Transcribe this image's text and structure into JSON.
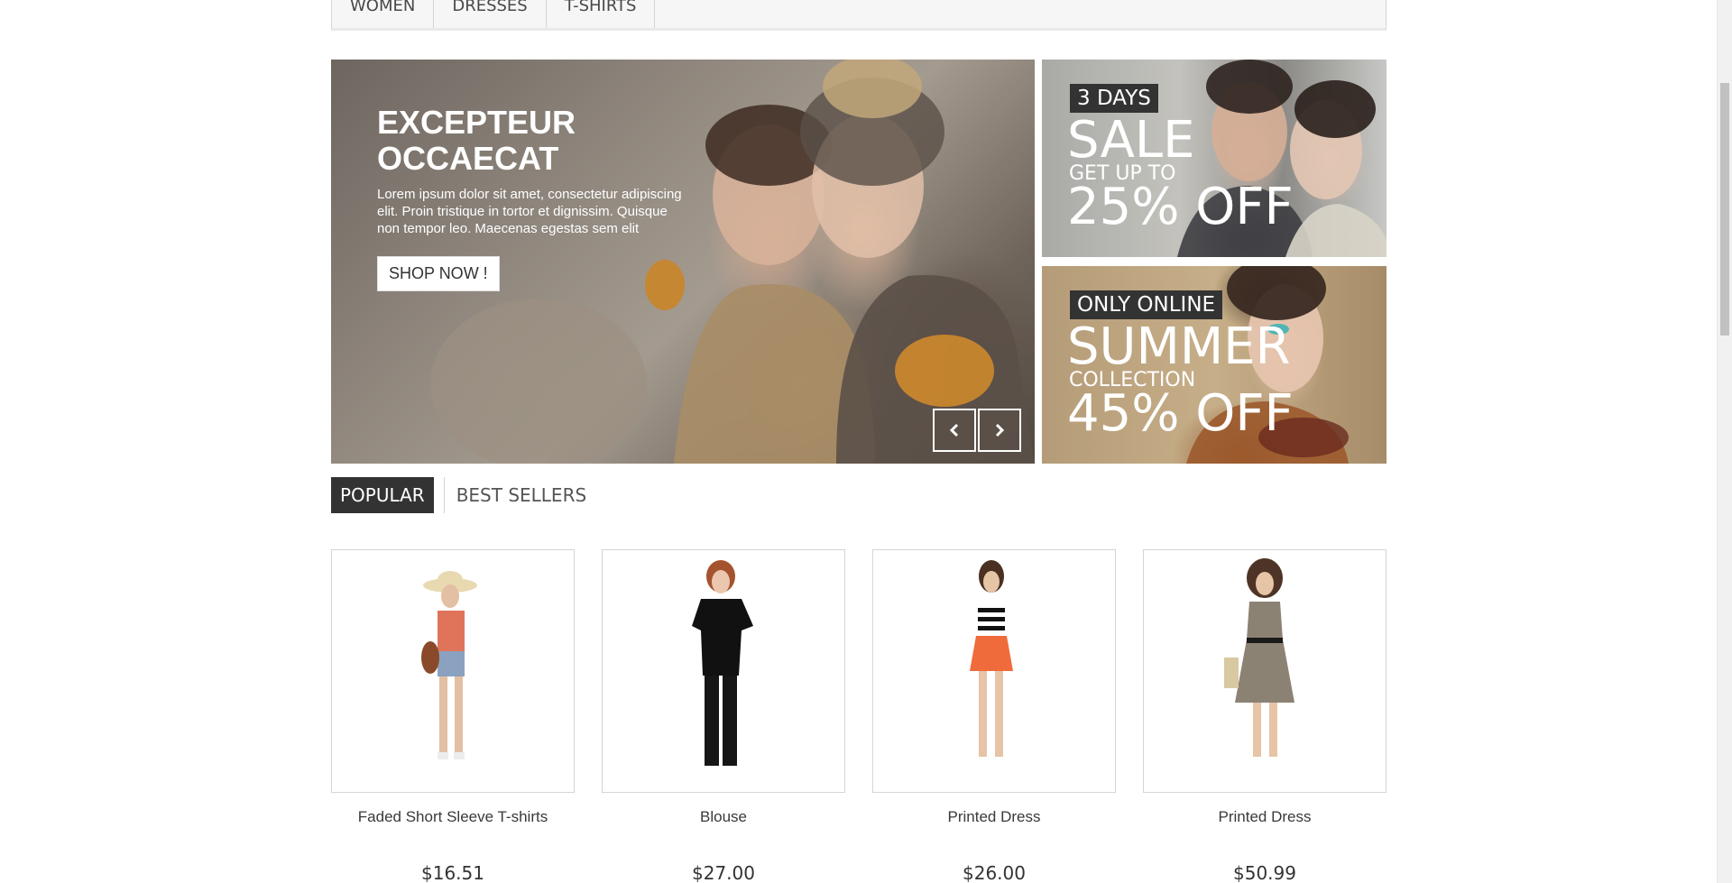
{
  "nav": {
    "items": [
      "WOMEN",
      "DRESSES",
      "T-SHIRTS"
    ]
  },
  "hero": {
    "title": "EXCEPTEUR\nOCCAECAT",
    "description": "Lorem ipsum dolor sit amet, consectetur adipiscing elit. Proin tristique in tortor et dignissim. Quisque non tempor leo. Maecenas egestas sem elit",
    "button_label": "SHOP NOW !",
    "prev_icon": "chevron-left-icon",
    "next_icon": "chevron-right-icon"
  },
  "banners": [
    {
      "tag": "3 DAYS",
      "headline": "SALE",
      "subline": "GET UP TO",
      "offer": "25% OFF"
    },
    {
      "tag": "ONLY ONLINE",
      "headline": "SUMMER",
      "subline": "COLLECTION",
      "offer": "45% OFF"
    }
  ],
  "tabs": {
    "active": "POPULAR",
    "inactive": "BEST SELLERS"
  },
  "products": [
    {
      "name": "Faded Short Sleeve T-shirts",
      "price": "$16.51"
    },
    {
      "name": "Blouse",
      "price": "$27.00"
    },
    {
      "name": "Printed Dress",
      "price": "$26.00"
    },
    {
      "name": "Printed Dress",
      "price": "$50.99"
    }
  ],
  "colors": {
    "dark": "#333333",
    "border": "#d6d4d4",
    "nav_bg": "#f6f6f6"
  }
}
